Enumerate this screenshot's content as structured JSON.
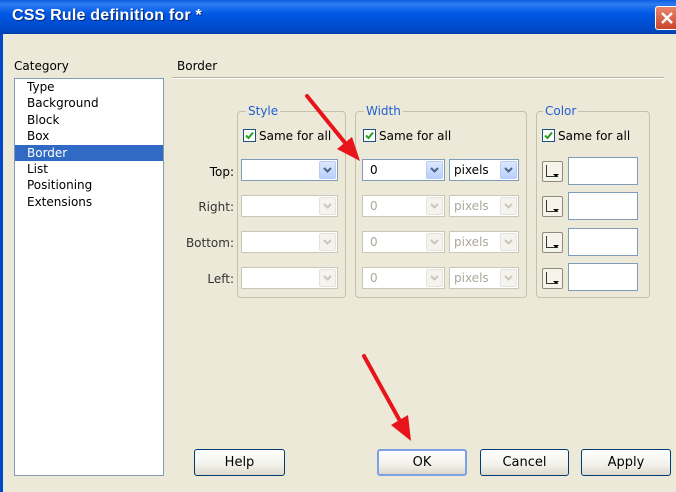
{
  "window": {
    "title": "CSS Rule definition for *"
  },
  "category": {
    "label": "Category",
    "items": [
      "Type",
      "Background",
      "Block",
      "Box",
      "Border",
      "List",
      "Positioning",
      "Extensions"
    ],
    "selected": "Border"
  },
  "section": {
    "label": "Border"
  },
  "groups": {
    "style": {
      "title": "Style",
      "same_for_all": "Same for all"
    },
    "width": {
      "title": "Width",
      "same_for_all": "Same for all"
    },
    "color": {
      "title": "Color",
      "same_for_all": "Same for all"
    }
  },
  "rows": [
    {
      "label": "Top:",
      "style": "",
      "width": "0",
      "unit": "pixels",
      "color": "",
      "enabled": true
    },
    {
      "label": "Right:",
      "style": "",
      "width": "0",
      "unit": "pixels",
      "color": "",
      "enabled": false
    },
    {
      "label": "Bottom:",
      "style": "",
      "width": "0",
      "unit": "pixels",
      "color": "",
      "enabled": false
    },
    {
      "label": "Left:",
      "style": "",
      "width": "0",
      "unit": "pixels",
      "color": "",
      "enabled": false
    }
  ],
  "buttons": {
    "help": "Help",
    "ok": "OK",
    "cancel": "Cancel",
    "apply": "Apply"
  },
  "colors": {
    "annotation_arrow": "#E8141C",
    "title_bar": "#0058E6",
    "selection": "#316AC5"
  }
}
